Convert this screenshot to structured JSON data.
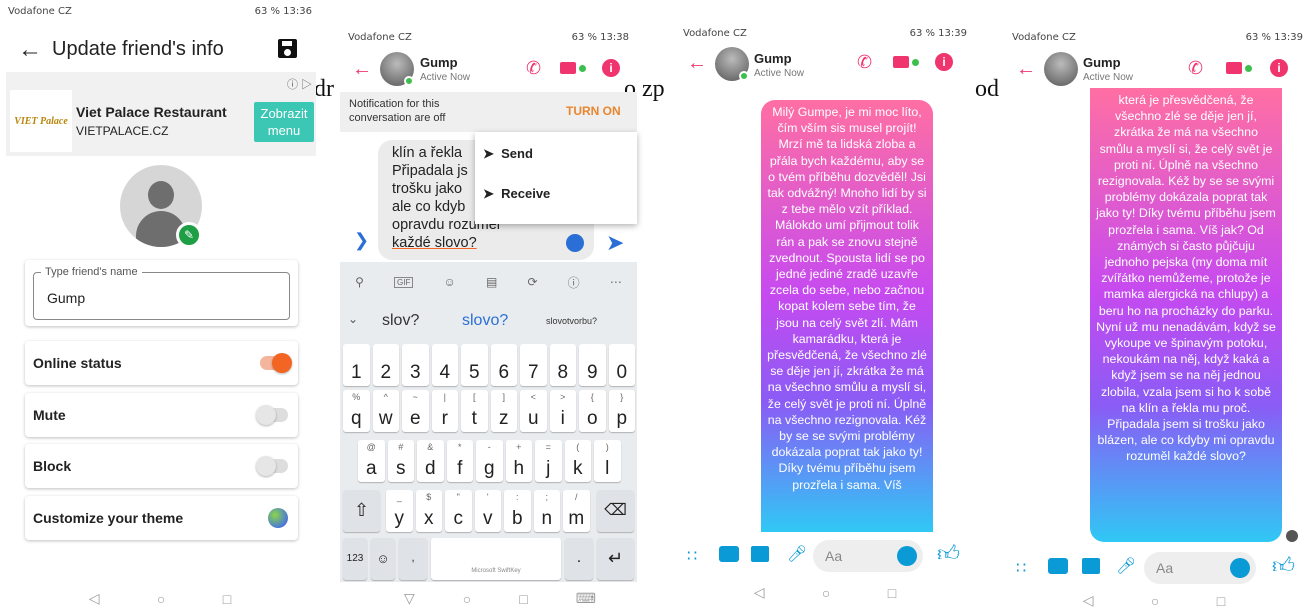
{
  "status_bars": [
    {
      "carrier": "Vodafone CZ",
      "right": "63 % 13:36"
    },
    {
      "carrier": "Vodafone CZ",
      "right": "63 % 13:38"
    },
    {
      "carrier": "Vodafone CZ",
      "right": "63 % 13:39"
    },
    {
      "carrier": "Vodafone CZ",
      "right": "63 % 13:39"
    }
  ],
  "fragments": [
    "dr",
    "o zp",
    "od"
  ],
  "phone1": {
    "title": "Update friend's info",
    "ad": {
      "name": "Viet Palace Restaurant",
      "domain": "VIETPALACE.CZ",
      "button": "Zobrazit menu",
      "logo_text": "VIET Palace"
    },
    "field_label": "Type friend's name",
    "field_value": "Gump",
    "settings": [
      {
        "label": "Online status",
        "on": true
      },
      {
        "label": "Mute",
        "on": false
      },
      {
        "label": "Block",
        "on": false
      },
      {
        "label": "Customize your theme"
      }
    ]
  },
  "chat_header": {
    "name": "Gump",
    "status": "Active Now"
  },
  "phone2": {
    "notification": "Notification for this conversation are off",
    "turn_on": "TURN ON",
    "compose_lines": [
      "klín a řekla",
      "Připadala js",
      "trošku jako",
      "ale co kdyb",
      "opravdu rozuměl",
      "každé slovo?"
    ],
    "menu": [
      "Send",
      "Receive"
    ],
    "suggestions": [
      "slov?",
      "slovo?",
      "slovotvorbu?"
    ],
    "toolbar_gif": "GIF",
    "number_row": [
      "1",
      "2",
      "3",
      "4",
      "5",
      "6",
      "7",
      "8",
      "9",
      "0"
    ],
    "row1": [
      {
        "k": "q",
        "h": "%"
      },
      {
        "k": "w",
        "h": "^"
      },
      {
        "k": "e",
        "h": "~"
      },
      {
        "k": "r",
        "h": "|"
      },
      {
        "k": "t",
        "h": "["
      },
      {
        "k": "z",
        "h": "]"
      },
      {
        "k": "u",
        "h": "<"
      },
      {
        "k": "i",
        "h": ">"
      },
      {
        "k": "o",
        "h": "{"
      },
      {
        "k": "p",
        "h": "}"
      }
    ],
    "row2": [
      {
        "k": "a",
        "h": "@"
      },
      {
        "k": "s",
        "h": "#"
      },
      {
        "k": "d",
        "h": "&"
      },
      {
        "k": "f",
        "h": "*"
      },
      {
        "k": "g",
        "h": "-"
      },
      {
        "k": "h",
        "h": "+"
      },
      {
        "k": "j",
        "h": "="
      },
      {
        "k": "k",
        "h": "("
      },
      {
        "k": "l",
        "h": ")"
      }
    ],
    "row3": [
      {
        "k": "y",
        "h": "_"
      },
      {
        "k": "x",
        "h": "$"
      },
      {
        "k": "c",
        "h": "\""
      },
      {
        "k": "v",
        "h": "'"
      },
      {
        "k": "b",
        "h": ":"
      },
      {
        "k": "n",
        "h": ";"
      },
      {
        "k": "m",
        "h": "/"
      }
    ],
    "sym_key": "123",
    "space_label": "Microsoft SwiftKey"
  },
  "phone3": {
    "message": "Milý Gumpe, je mi moc líto, čím vším sis musel projít! Mrzí mě ta lidská zloba a přála bych každému, aby se o tvém příběhu dozvěděl! Jsi tak odvážný! Mnoho lidí by si z tebe mělo vzít příklad. Málokdo umí přijmout tolik rán a pak se znovu stejně zvednout. Spousta lidí se po jedné jediné zradě uzavře zcela do sebe, nebo začnou kopat kolem sebe tím, že jsou na celý svět zlí. Mám kamarádku, která je přesvědčená, že všechno zlé se děje jen jí, zkrátka že má na všechno smůlu a myslí si, že celý svět je proti ní. Úplně na všechno rezignovala. Kéž by se se svými problémy dokázala poprat tak jako ty! Díky tvému příběhu jsem prozřela i sama. Víš",
    "input_placeholder": "Aa"
  },
  "phone4": {
    "message": "která je přesvědčená, že všechno zlé se děje jen jí, zkrátka že má na všechno smůlu a myslí si, že celý svět je proti ní. Úplně na všechno rezignovala. Kéž by se se svými problémy dokázala poprat tak jako ty! Díky tvému příběhu jsem prozřela i sama. Víš jak? Od známých si často půjčuju jednoho pejska (my doma mít zvířátko nemůžeme, protože je mamka alergická na chlupy) a beru ho na procházky do parku. Nyní už mu nenadávám, když se vykoupe ve špinavým potoku, nekoukám na něj, když kaká a když jsem se na něj jednou zlobila, vzala jsem si ho k sobě na klín a řekla mu proč. Připadala jsem si trošku jako blázen, ale co kdyby mi opravdu rozuměl každé slovo?",
    "input_placeholder": "Aa"
  },
  "colors": {
    "accent": "#f26522",
    "messenger_pink": "#f0356e",
    "messenger_blue": "#0a9ad6",
    "teal": "#3cc6b4"
  }
}
